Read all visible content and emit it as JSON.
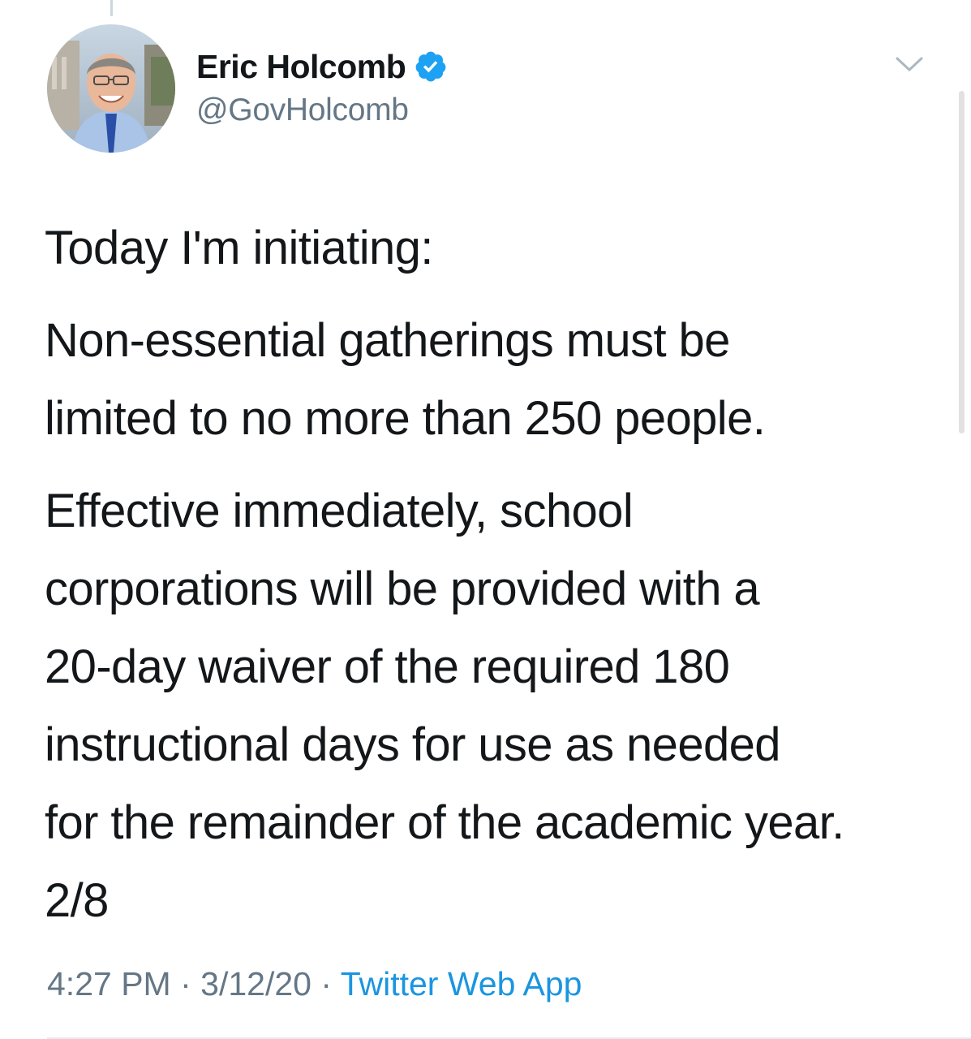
{
  "author": {
    "display_name": "Eric Holcomb",
    "handle": "@GovHolcomb",
    "verified": true,
    "avatar_icon": "profile-photo"
  },
  "tweet": {
    "paragraphs": [
      "Today I'm initiating:",
      "Non-essential gatherings must be\nlimited to no more than 250 people.",
      "Effective immediately, school\ncorporations will be provided with a\n20-day waiver of the required 180\ninstructional days for use as needed\nfor the remainder of the academic year.\n2/8"
    ]
  },
  "meta": {
    "time": "4:27 PM",
    "separator": "·",
    "date": "3/12/20",
    "source": "Twitter Web App"
  },
  "colors": {
    "text": "#14171a",
    "secondary": "#657786",
    "accent": "#1b95e0",
    "verified_badge": "#1da1f2"
  },
  "icons": {
    "verified": "verified-badge-icon",
    "menu": "chevron-down-icon"
  }
}
